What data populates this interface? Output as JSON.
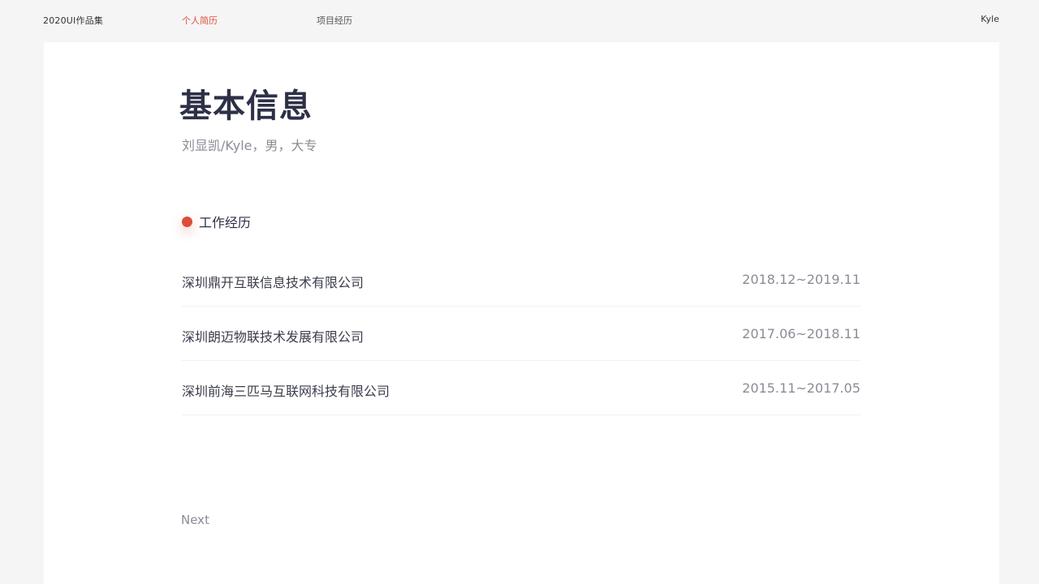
{
  "header": {
    "brand": "2020UI作品集",
    "nav": [
      {
        "label": "个人简历",
        "active": true
      },
      {
        "label": "项目经历",
        "active": false
      }
    ],
    "user": "Kyle"
  },
  "profile": {
    "title": "基本信息",
    "subtitle": "刘显凯/Kyle，男，大专"
  },
  "work": {
    "heading": "工作经历",
    "jobs": [
      {
        "company": "深圳鼎开互联信息技术有限公司",
        "period": "2018.12~2019.11"
      },
      {
        "company": "深圳朗迈物联技术发展有限公司",
        "period": "2017.06~2018.11"
      },
      {
        "company": "深圳前海三匹马互联网科技有限公司",
        "period": "2015.11~2017.05"
      }
    ]
  },
  "footer": {
    "next_label": "Next"
  },
  "colors": {
    "accent": "#e0523f",
    "dot": "#dd4b3a",
    "title": "#2d3047",
    "muted": "#8a8c96",
    "background": "#f5f5f5",
    "card": "#ffffff"
  }
}
